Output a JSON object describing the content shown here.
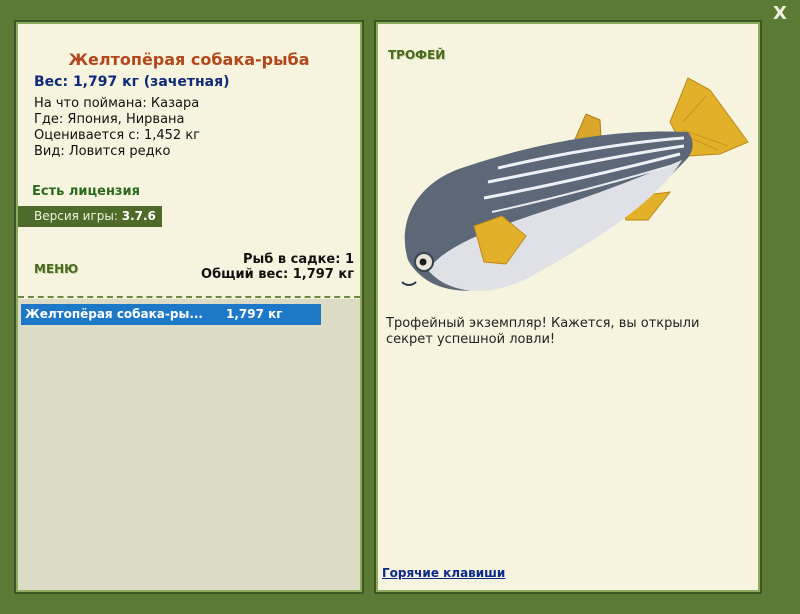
{
  "close_label": "X",
  "left": {
    "fish_name": "Желтопёрая собака-рыба",
    "weight_line": "Вес: 1,797 кг (зачетная)",
    "info": [
      "На что поймана: Казара",
      "Где: Япония, Нирвана",
      "Оценивается с: 1,452 кг",
      "Вид: Ловится редко"
    ],
    "license": "Есть лицензия",
    "version_label": "Версия игры:",
    "version_value": "3.7.6",
    "menu_title": "МЕНЮ",
    "stats": {
      "in_net": "Рыб в садке: 1",
      "total_weight": "Общий вес: 1,797 кг"
    },
    "list": [
      {
        "name": "Желтопёрая собака-ры...",
        "weight": "1,797 кг",
        "selected": true
      }
    ]
  },
  "right": {
    "trophy_title": "ТРОФЕЙ",
    "description": "Трофейный экземпляр! Кажется, вы открыли секрет успешной ловли!",
    "hotkeys": "Горячие клавиши"
  },
  "colors": {
    "frame_green": "#5b7a33",
    "panel_bg": "#f6f4df",
    "title_orange": "#b4461b",
    "weight_navy": "#0e2b79",
    "selection_blue": "#1e78c8",
    "fin_yellow": "#e3b02a"
  }
}
